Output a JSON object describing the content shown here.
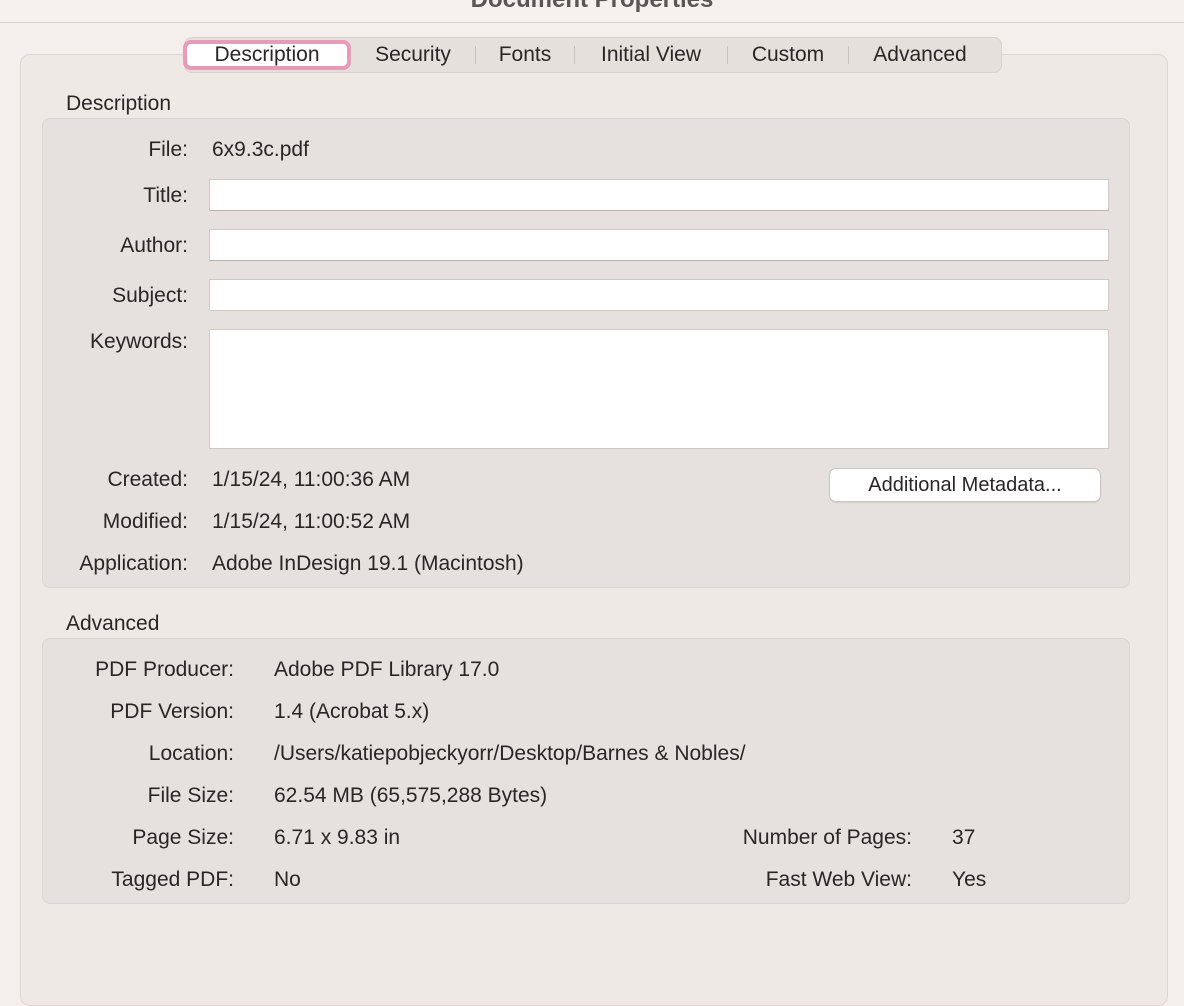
{
  "window": {
    "title": "Document Properties"
  },
  "tabs": [
    {
      "label": "Description"
    },
    {
      "label": "Security"
    },
    {
      "label": "Fonts"
    },
    {
      "label": "Initial View"
    },
    {
      "label": "Custom"
    },
    {
      "label": "Advanced"
    }
  ],
  "selected_tab": "Description",
  "description": {
    "section_title": "Description",
    "file_label": "File:",
    "file_value": "6x9.3c.pdf",
    "title_label": "Title:",
    "title_value": "",
    "author_label": "Author:",
    "author_value": "",
    "subject_label": "Subject:",
    "subject_value": "",
    "keywords_label": "Keywords:",
    "keywords_value": "",
    "created_label": "Created:",
    "created_value": "1/15/24, 11:00:36 AM",
    "modified_label": "Modified:",
    "modified_value": "1/15/24, 11:00:52 AM",
    "application_label": "Application:",
    "application_value": "Adobe InDesign 19.1 (Macintosh)",
    "metadata_button": "Additional Metadata..."
  },
  "advanced": {
    "section_title": "Advanced",
    "producer_label": "PDF Producer:",
    "producer_value": "Adobe PDF Library 17.0",
    "version_label": "PDF Version:",
    "version_value": "1.4 (Acrobat 5.x)",
    "location_label": "Location:",
    "location_value": "/Users/katiepobjeckyorr/Desktop/Barnes & Nobles/",
    "filesize_label": "File Size:",
    "filesize_value": "62.54 MB (65,575,288 Bytes)",
    "pagesize_label": "Page Size:",
    "pagesize_value": "6.71 x 9.83 in",
    "pages_label": "Number of Pages:",
    "pages_value": "37",
    "tagged_label": "Tagged PDF:",
    "tagged_value": "No",
    "fastweb_label": "Fast Web View:",
    "fastweb_value": "Yes"
  },
  "colors": {
    "selected_tab_ring": "#e89bb8",
    "background": "#f4efec",
    "group_background": "#e6e0de"
  }
}
